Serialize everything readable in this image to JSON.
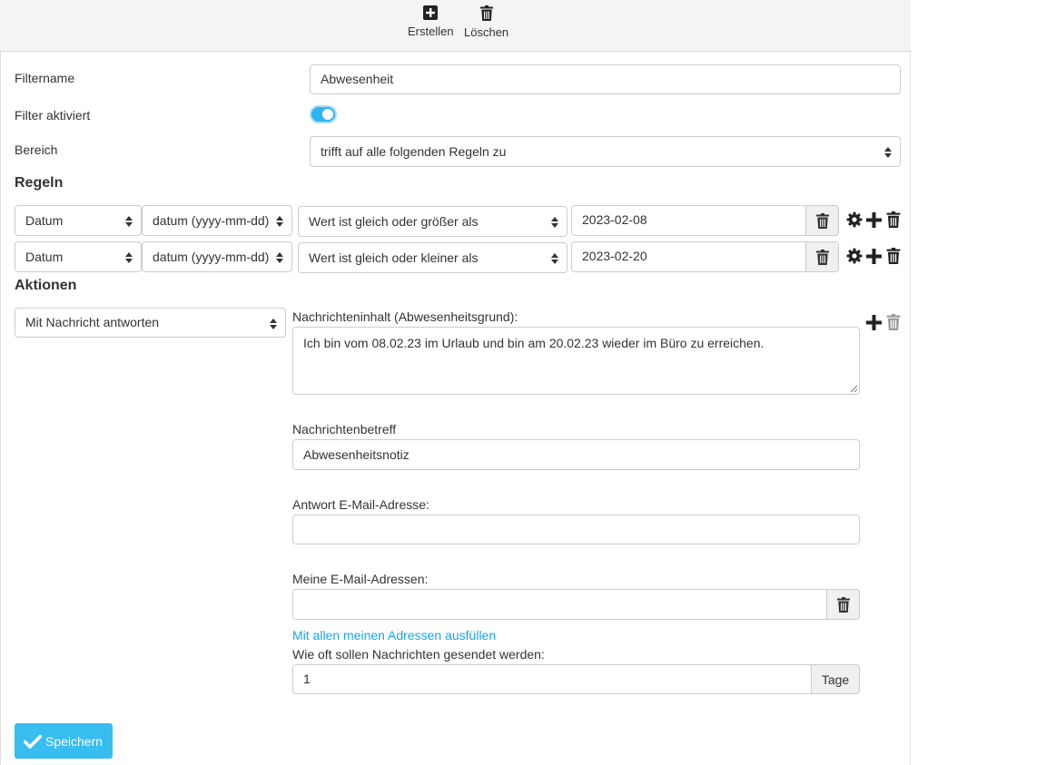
{
  "toolbar": {
    "create_label": "Erstellen",
    "delete_label": "Löschen"
  },
  "form": {
    "filtername_label": "Filtername",
    "filtername_value": "Abwesenheit",
    "filter_enabled_label": "Filter aktiviert",
    "filter_enabled": true,
    "scope_label": "Bereich",
    "scope_value": "trifft auf alle folgenden Regeln zu"
  },
  "rules": {
    "heading": "Regeln",
    "items": [
      {
        "field": "Datum",
        "format": "datum (yyyy-mm-dd)",
        "operator": "Wert ist gleich oder größer als",
        "value": "2023-02-08"
      },
      {
        "field": "Datum",
        "format": "datum (yyyy-mm-dd)",
        "operator": "Wert ist gleich oder kleiner als",
        "value": "2023-02-20"
      }
    ]
  },
  "actions": {
    "heading": "Aktionen",
    "action_type": "Mit Nachricht antworten",
    "message_label": "Nachrichteninhalt (Abwesenheitsgrund):",
    "message_value": "Ich bin vom 08.02.23 im Urlaub und bin am 20.02.23 wieder im Büro zu erreichen.",
    "subject_label": "Nachrichtenbetreff",
    "subject_value": "Abwesenheitsnotiz",
    "reply_address_label": "Antwort E-Mail-Adresse:",
    "reply_address_value": "",
    "my_addresses_label": "Meine E-Mail-Adressen:",
    "my_addresses_value": "",
    "fill_all_link": "Mit allen meinen Adressen ausfüllen",
    "frequency_label": "Wie oft sollen Nachrichten gesendet werden:",
    "frequency_value": "1",
    "frequency_unit": "Tage"
  },
  "save_label": "Speichern",
  "colors": {
    "accent": "#37bdf0",
    "link": "#1aa3e8",
    "toolbar_bg": "#f4f4f4"
  }
}
